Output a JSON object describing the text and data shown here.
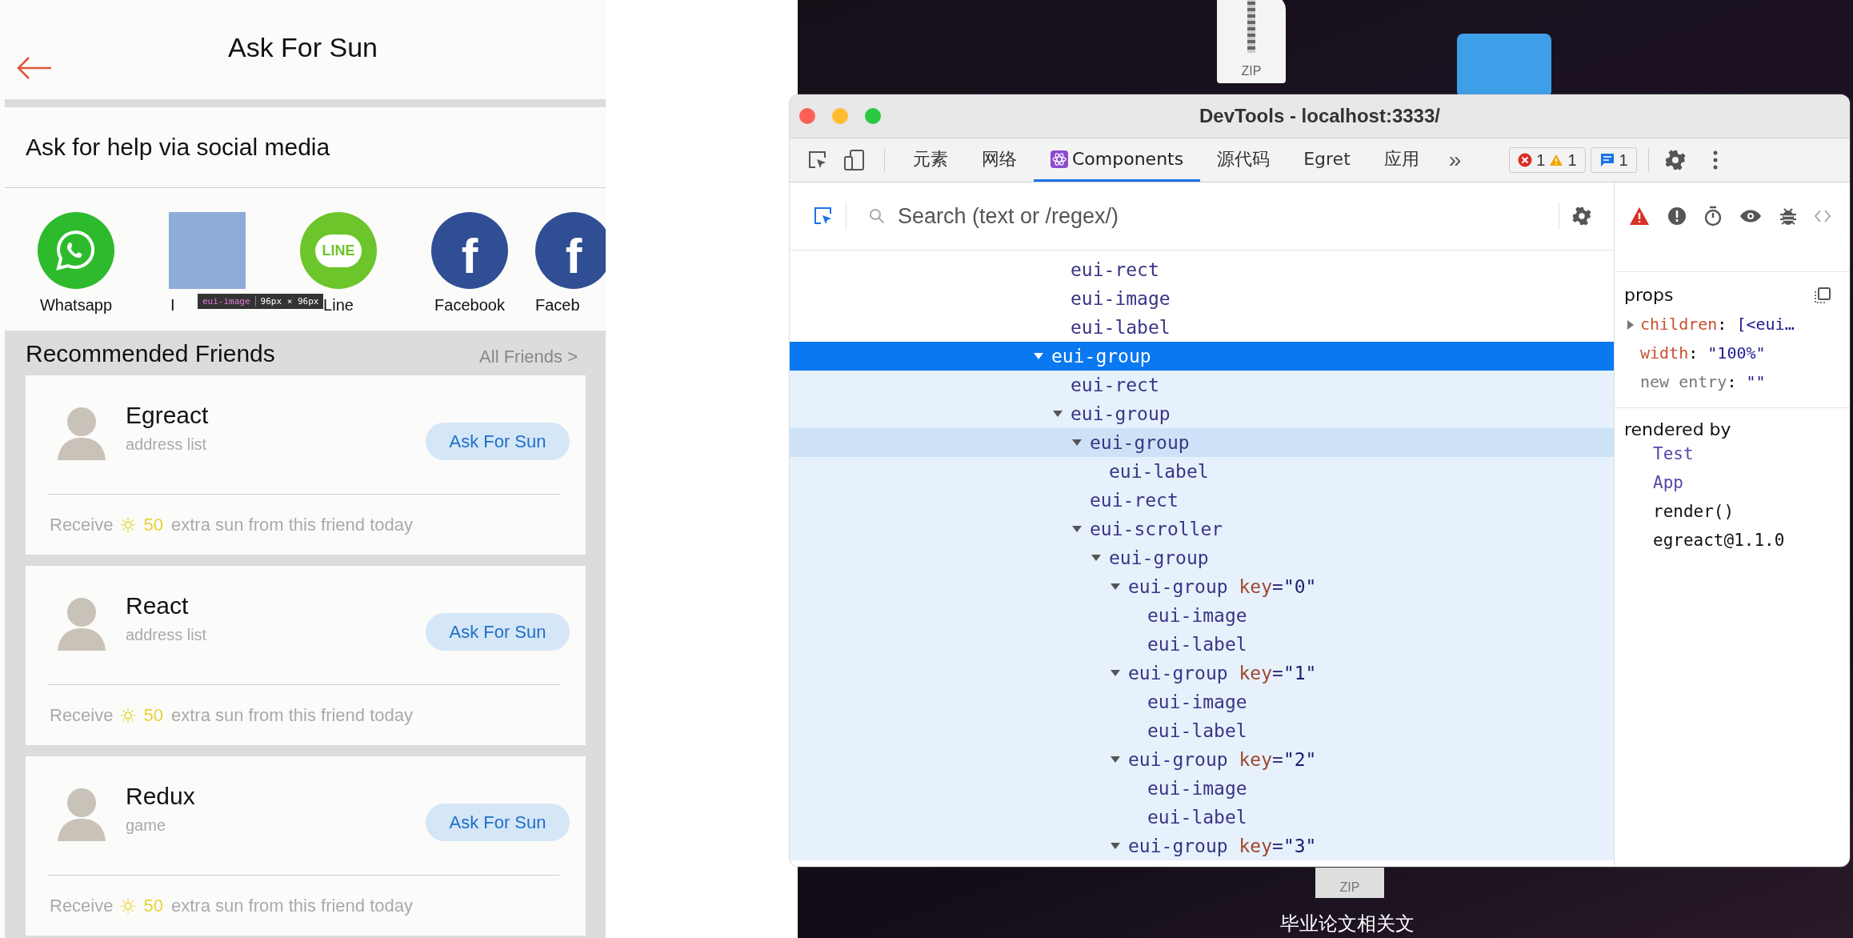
{
  "app": {
    "title": "Ask For Sun",
    "section_title": "Ask for help via social media",
    "social": [
      {
        "kind": "whatsapp",
        "label": "Whatsapp",
        "inspected": false
      },
      {
        "kind": "instagram",
        "label": "I",
        "inspected": true
      },
      {
        "kind": "line",
        "label": "Line",
        "logo_text": "LINE",
        "inspected": false
      },
      {
        "kind": "facebook",
        "label": "Facebook",
        "logo_text": "f",
        "inspected": false
      },
      {
        "kind": "facebook",
        "label": "Faceb",
        "logo_text": "f",
        "inspected": false
      }
    ],
    "inspector_tooltip": {
      "tag": "eui-image",
      "size": "96px × 96px"
    },
    "friends_title": "Recommended Friends",
    "all_friends": "All Friends >",
    "friends": [
      {
        "name": "Egreact",
        "source": "address list",
        "button": "Ask For Sun",
        "reward_prefix": "Receive",
        "reward_amount": "50",
        "reward_suffix": "extra sun from this friend today"
      },
      {
        "name": "React",
        "source": "address list",
        "button": "Ask For Sun",
        "reward_prefix": "Receive",
        "reward_amount": "50",
        "reward_suffix": "extra sun from this friend today"
      },
      {
        "name": "Redux",
        "source": "game",
        "button": "Ask For Sun",
        "reward_prefix": "Receive",
        "reward_amount": "50",
        "reward_suffix": "extra sun from this friend today"
      }
    ]
  },
  "desktop": {
    "items": [
      {
        "kind": "zip",
        "icon_text": "ZIP"
      },
      {
        "kind": "folder"
      },
      {
        "kind": "zip_partial",
        "icon_text": "ZIP",
        "caption": "毕业论文相关文"
      }
    ]
  },
  "devtools": {
    "title": "DevTools - localhost:3333/",
    "tabs": [
      {
        "label": "元素",
        "kind": "text",
        "selected": false
      },
      {
        "label": "网络",
        "kind": "text",
        "selected": false
      },
      {
        "label": "Components",
        "kind": "react",
        "selected": true
      },
      {
        "label": "源代码",
        "kind": "text",
        "selected": false
      },
      {
        "label": "Egret",
        "kind": "text",
        "selected": false
      },
      {
        "label": "应用",
        "kind": "text",
        "selected": false
      }
    ],
    "more": "»",
    "counts": {
      "errors": "1",
      "warnings": "1",
      "messages": "1"
    },
    "search_placeholder": "Search (text or /regex/)",
    "tree_leading": [
      {
        "label": "eui-rect",
        "selected": false,
        "hovered": false
      },
      {
        "label": "eui-image",
        "selected": false,
        "hovered": false
      },
      {
        "label": "eui-label",
        "selected": false,
        "hovered": false
      }
    ],
    "tree": [
      {
        "label": "eui-group",
        "selected": true,
        "hovered": false,
        "expanded": true,
        "children": [
          {
            "label": "eui-rect",
            "selected": false,
            "hovered": false
          },
          {
            "label": "eui-group",
            "selected": false,
            "hovered": false,
            "expanded": true,
            "children": [
              {
                "label": "eui-group",
                "selected": false,
                "hovered": true,
                "expanded": true,
                "children": [
                  {
                    "label": "eui-label",
                    "selected": false,
                    "hovered": false
                  }
                ]
              },
              {
                "label": "eui-rect",
                "selected": false,
                "hovered": false
              },
              {
                "label": "eui-scroller",
                "selected": false,
                "hovered": false,
                "expanded": true,
                "children": [
                  {
                    "label": "eui-group",
                    "selected": false,
                    "hovered": false,
                    "expanded": true,
                    "children": [
                      {
                        "label": "eui-group",
                        "attr_name": "key",
                        "attr_eq": "=",
                        "attr_value": "\"0\"",
                        "selected": false,
                        "hovered": false,
                        "expanded": true,
                        "children": [
                          {
                            "label": "eui-image",
                            "selected": false,
                            "hovered": false
                          },
                          {
                            "label": "eui-label",
                            "selected": false,
                            "hovered": false
                          }
                        ]
                      },
                      {
                        "label": "eui-group",
                        "attr_name": "key",
                        "attr_eq": "=",
                        "attr_value": "\"1\"",
                        "selected": false,
                        "hovered": false,
                        "expanded": true,
                        "children": [
                          {
                            "label": "eui-image",
                            "selected": false,
                            "hovered": false
                          },
                          {
                            "label": "eui-label",
                            "selected": false,
                            "hovered": false
                          }
                        ]
                      },
                      {
                        "label": "eui-group",
                        "attr_name": "key",
                        "attr_eq": "=",
                        "attr_value": "\"2\"",
                        "selected": false,
                        "hovered": false,
                        "expanded": true,
                        "children": [
                          {
                            "label": "eui-image",
                            "selected": false,
                            "hovered": false
                          },
                          {
                            "label": "eui-label",
                            "selected": false,
                            "hovered": false
                          }
                        ]
                      },
                      {
                        "label": "eui-group",
                        "attr_name": "key",
                        "attr_eq": "=",
                        "attr_value": "\"3\"",
                        "selected": false,
                        "hovered": false,
                        "expanded": true
                      }
                    ]
                  }
                ]
              }
            ]
          }
        ]
      }
    ],
    "props_title": "props",
    "props": [
      {
        "kind": "expandable",
        "name": "children",
        "sep": ":",
        "value": "[<eui…"
      },
      {
        "kind": "plain",
        "name": "width",
        "sep": ":",
        "value": "\"100%\""
      },
      {
        "kind": "new",
        "name": "new entry",
        "sep": ":",
        "value": "\"\""
      }
    ],
    "rendered_by_title": "rendered by",
    "rendered_by": [
      {
        "kind": "component",
        "label": "Test"
      },
      {
        "kind": "component",
        "label": "App"
      },
      {
        "kind": "text",
        "label": "render()"
      },
      {
        "kind": "text",
        "label": "egreact@1.1.0"
      }
    ]
  }
}
